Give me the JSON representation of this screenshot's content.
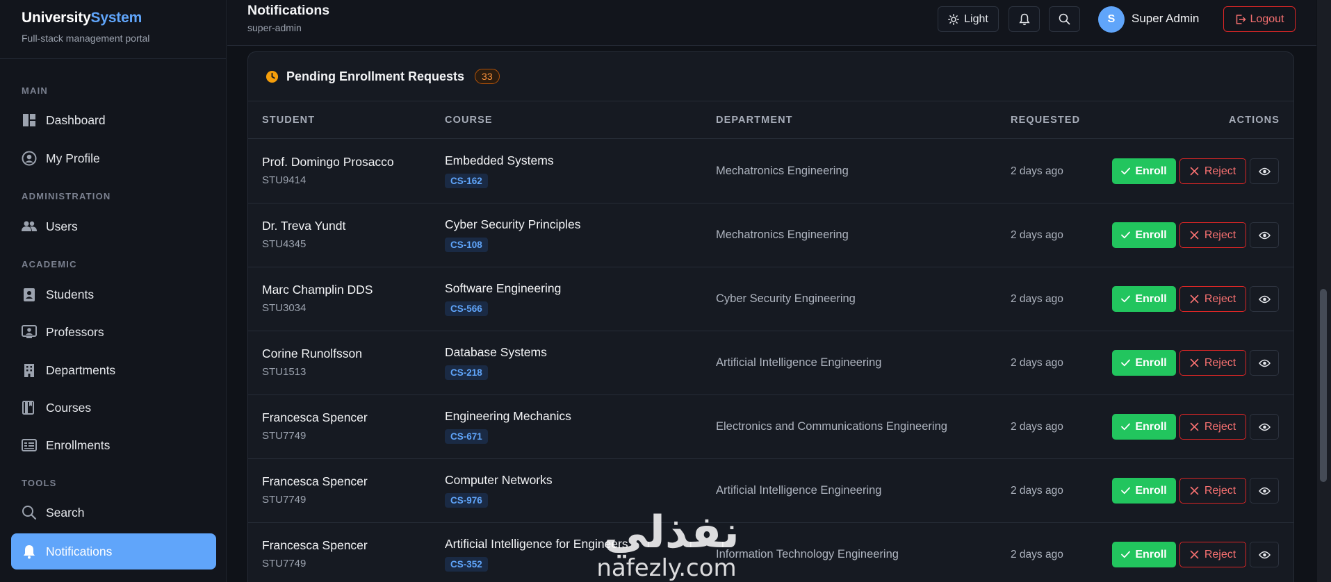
{
  "brand": {
    "name_part1": "University",
    "name_part2": "System",
    "tagline": "Full-stack management portal"
  },
  "sidebar": {
    "sections": [
      "MAIN",
      "ADMINISTRATION",
      "ACADEMIC",
      "TOOLS"
    ],
    "items": [
      {
        "label": "Dashboard",
        "icon": "dashboard-icon"
      },
      {
        "label": "My Profile",
        "icon": "user-circle-icon"
      },
      {
        "label": "Users",
        "icon": "users-icon"
      },
      {
        "label": "Students",
        "icon": "student-badge-icon"
      },
      {
        "label": "Professors",
        "icon": "professor-icon"
      },
      {
        "label": "Departments",
        "icon": "building-icon"
      },
      {
        "label": "Courses",
        "icon": "book-icon"
      },
      {
        "label": "Enrollments",
        "icon": "enrollment-card-icon"
      },
      {
        "label": "Search",
        "icon": "search-icon"
      },
      {
        "label": "Notifications",
        "icon": "bell-icon",
        "active": true
      }
    ]
  },
  "header": {
    "title": "Notifications",
    "subtitle": "super-admin",
    "theme_label": "Light",
    "user_initial": "S",
    "user_name": "Super Admin",
    "logout_label": "Logout"
  },
  "card": {
    "title": "Pending Enrollment Requests",
    "count": "33",
    "columns": [
      "STUDENT",
      "COURSE",
      "DEPARTMENT",
      "REQUESTED",
      "ACTIONS"
    ],
    "enroll_label": "Enroll",
    "reject_label": "Reject",
    "rows": [
      {
        "student": "Prof. Domingo Prosacco",
        "id": "STU9414",
        "course": "Embedded Systems",
        "code": "CS-162",
        "department": "Mechatronics Engineering",
        "requested": "2 days ago"
      },
      {
        "student": "Dr. Treva Yundt",
        "id": "STU4345",
        "course": "Cyber Security Principles",
        "code": "CS-108",
        "department": "Mechatronics Engineering",
        "requested": "2 days ago"
      },
      {
        "student": "Marc Champlin DDS",
        "id": "STU3034",
        "course": "Software Engineering",
        "code": "CS-566",
        "department": "Cyber Security Engineering",
        "requested": "2 days ago"
      },
      {
        "student": "Corine Runolfsson",
        "id": "STU1513",
        "course": "Database Systems",
        "code": "CS-218",
        "department": "Artificial Intelligence Engineering",
        "requested": "2 days ago"
      },
      {
        "student": "Francesca Spencer",
        "id": "STU7749",
        "course": "Engineering Mechanics",
        "code": "CS-671",
        "department": "Electronics and Communications Engineering",
        "requested": "2 days ago"
      },
      {
        "student": "Francesca Spencer",
        "id": "STU7749",
        "course": "Computer Networks",
        "code": "CS-976",
        "department": "Artificial Intelligence Engineering",
        "requested": "2 days ago"
      },
      {
        "student": "Francesca Spencer",
        "id": "STU7749",
        "course": "Artificial Intelligence for Engineers",
        "code": "CS-352",
        "department": "Information Technology Engineering",
        "requested": "2 days ago"
      }
    ]
  },
  "watermark": {
    "arabic": "نفذلي",
    "latin": "nafezly.com"
  },
  "colors": {
    "accent": "#60a5fa",
    "success": "#22c55e",
    "danger": "#dc2626",
    "warning": "#f59e0b"
  }
}
